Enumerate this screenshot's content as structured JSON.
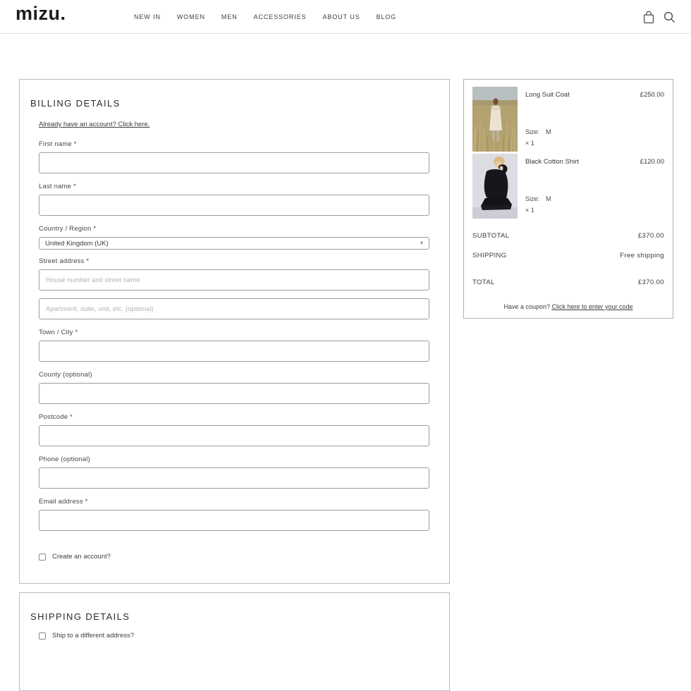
{
  "brand": {
    "logo": "mizu."
  },
  "nav": {
    "items": [
      "NEW IN",
      "WOMEN",
      "MEN",
      "ACCESSORIES",
      "ABOUT US",
      "BLOG"
    ]
  },
  "icons": {
    "select_arrow": "▾"
  },
  "billing": {
    "title": "BILLING DETAILS",
    "account_prompt": "Already have an account? Click here.",
    "first_name_label": "First name *",
    "last_name_label": "Last name *",
    "country_label": "Country / Region *",
    "country_value": "United Kingdom (UK)",
    "street_label": "Street address *",
    "street_placeholder": "House number and street name",
    "street2_placeholder": "Apartment, suite, unit, etc. (optional)",
    "town_label": "Town / City *",
    "county_label": "County (optional)",
    "postcode_label": "Postcode *",
    "phone_label": "Phone (optional)",
    "email_label": "Email address *",
    "create_account_label": "Create an account?"
  },
  "shipping": {
    "title": "SHIPPING DETAILS",
    "different_address_label": "Ship to a different address?"
  },
  "order_summary": {
    "items": [
      {
        "name": "Long Suit Coat",
        "price": "£250.00",
        "size_label": "Size:",
        "size_value": "M",
        "quantity": "× 1"
      },
      {
        "name": "Black Cotton Shirt",
        "price": "£120.00",
        "size_label": "Size:",
        "size_value": "M",
        "quantity": "× 1"
      }
    ],
    "subtotal_label": "SUBTOTAL",
    "subtotal_value": "£370.00",
    "shipping_label": "SHIPPING",
    "shipping_value": "Free shipping",
    "total_label": "TOTAL",
    "total_value": "£370.00",
    "coupon_prompt": "Have a coupon? ",
    "coupon_link": "Click here to enter your code"
  },
  "colors": {
    "text": "#3a3a3a",
    "panel_border": "#bcbcbc",
    "input_border": "#9c9c9c",
    "placeholder": "#b3b3b3"
  }
}
